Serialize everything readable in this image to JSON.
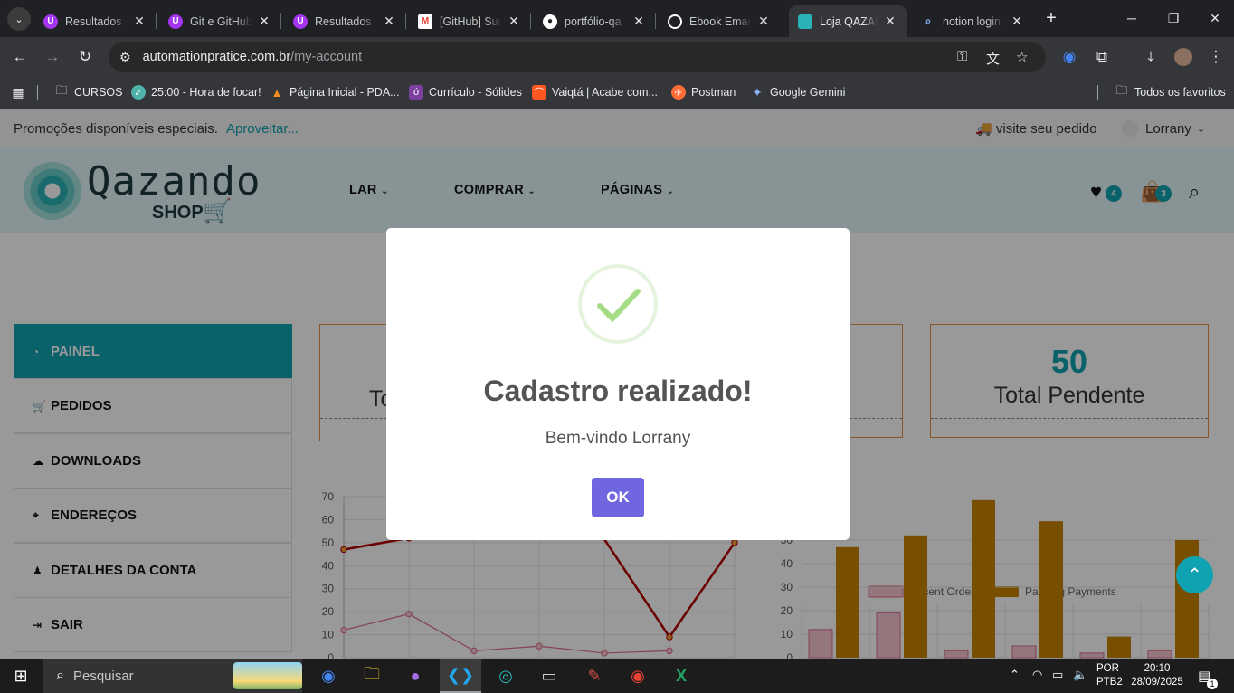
{
  "browser": {
    "tabs": [
      {
        "title": "Resultados d",
        "favicon": "udemy-icon",
        "color": "#a435f0"
      },
      {
        "title": "Git e GitHub",
        "favicon": "udemy-icon",
        "color": "#a435f0"
      },
      {
        "title": "Resultados d",
        "favicon": "udemy-icon",
        "color": "#a435f0"
      },
      {
        "title": "[GitHub] Suc",
        "favicon": "gmail-icon",
        "color": "#ea4335"
      },
      {
        "title": "portfólio-qa",
        "favicon": "github-icon",
        "color": "#ffffff"
      },
      {
        "title": "Ebook Emag",
        "favicon": "chatgpt-icon",
        "color": "#ffffff"
      },
      {
        "title": "Loja QAZAN",
        "favicon": "qazando-icon",
        "color": "#2ab3b6"
      },
      {
        "title": "notion login",
        "favicon": "search-icon",
        "color": "#8ab4f8"
      }
    ],
    "url_host": "automationpratice.com.br",
    "url_path": "/my-account",
    "bookmarks": [
      {
        "label": "CURSOS",
        "icon": "folder-icon"
      },
      {
        "label": "25:00 - Hora de focar!",
        "icon": "check-circle-icon"
      },
      {
        "label": "Página Inicial - PDA...",
        "icon": "pda-icon"
      },
      {
        "label": "Currículo - Sólides",
        "icon": "solides-icon"
      },
      {
        "label": "Vaiqtá | Acabe com...",
        "icon": "vaiqta-icon"
      },
      {
        "label": "Postman",
        "icon": "postman-icon"
      },
      {
        "label": "Google Gemini",
        "icon": "gemini-icon"
      }
    ],
    "all_bookmarks": "Todos os favoritos"
  },
  "site": {
    "promo_text": "Promoções disponíveis especiais.",
    "promo_link": "Aproveitar...",
    "track_order": "visite seu pedido",
    "user_name": "Lorrany",
    "logo_text": "Qazando",
    "logo_sub": "SHOP",
    "nav": [
      "LAR",
      "COMPRAR",
      "PÁGINAS"
    ],
    "wishlist_count": "4",
    "cart_count": "3",
    "sidebar": [
      "PAINEL",
      "PEDIDOS",
      "DOWNLOADS",
      "ENDEREÇOS",
      "DETALHES DA CONTA",
      "SAIR"
    ],
    "card1_label_partial": "To",
    "card3_value": "50",
    "card3_label": "Total Pendente"
  },
  "chart_data": [
    {
      "type": "line",
      "ylim": [
        0,
        70
      ],
      "yticks": [
        "70",
        "60",
        "50",
        "40",
        "30",
        "20",
        "10",
        "0"
      ],
      "series": [
        {
          "values": [
            47,
            52,
            null,
            null,
            null,
            9,
            50
          ],
          "color": "#b30000"
        },
        {
          "values": [
            12,
            19,
            3,
            5,
            2,
            3
          ],
          "color": "#e06b8a"
        }
      ]
    },
    {
      "type": "bar",
      "ylim": [
        0,
        70
      ],
      "yticks": [
        "50",
        "40",
        "30",
        "20",
        "10",
        "0"
      ],
      "legend": [
        "Recent Order",
        "Panding Payments"
      ],
      "series": [
        {
          "name": "Recent Order",
          "values": [
            12,
            19,
            3,
            5,
            2,
            3
          ],
          "color": "#f5c6d1"
        },
        {
          "name": "Panding Payments",
          "values": [
            47,
            52,
            67,
            58,
            9,
            50
          ],
          "color": "#c98200"
        }
      ]
    }
  ],
  "modal": {
    "title": "Cadastro realizado!",
    "text": "Bem-vindo Lorrany",
    "ok": "OK"
  },
  "taskbar": {
    "search": "Pesquisar",
    "lang": "POR",
    "layout": "PTB2",
    "time": "20:10",
    "date": "28/09/2025",
    "notifications": "1"
  }
}
